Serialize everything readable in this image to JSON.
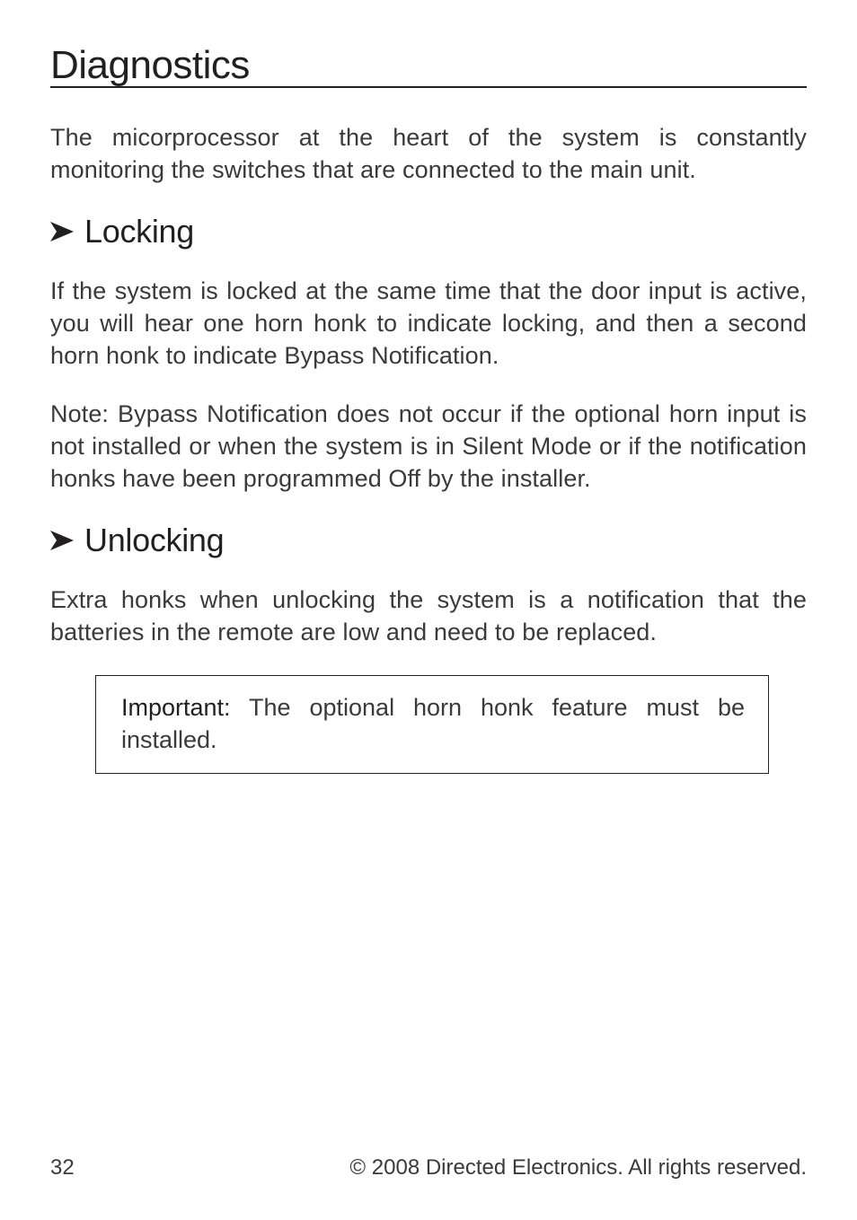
{
  "headings": {
    "title": "Diagnostics",
    "locking": "Locking",
    "unlocking": "Unlocking"
  },
  "paragraphs": {
    "intro": "The micorprocessor at the heart of the system is constantly monitoring the switches that are connected to the main unit.",
    "locking_body": "If the system is locked at the same time that the door input is active, you will hear one horn honk to indicate locking, and then a second horn honk to indicate Bypass Notification.",
    "note_label": "Note:",
    "note_body": " Bypass Notification does not occur if the optional horn input is not installed or when the system is in Silent Mode or if the notification honks have been programmed Off by the installer.",
    "unlocking_body": "Extra honks when unlocking the system is a notification that the batteries in the remote are low and need to be replaced.",
    "important_label": "Important:",
    "important_body": " The optional horn honk feature must be installed."
  },
  "footer": {
    "page_number": "32",
    "copyright": "© 2008 Directed Electronics. All rights reserved."
  },
  "icons": {
    "arrow": "arrowhead-right"
  }
}
